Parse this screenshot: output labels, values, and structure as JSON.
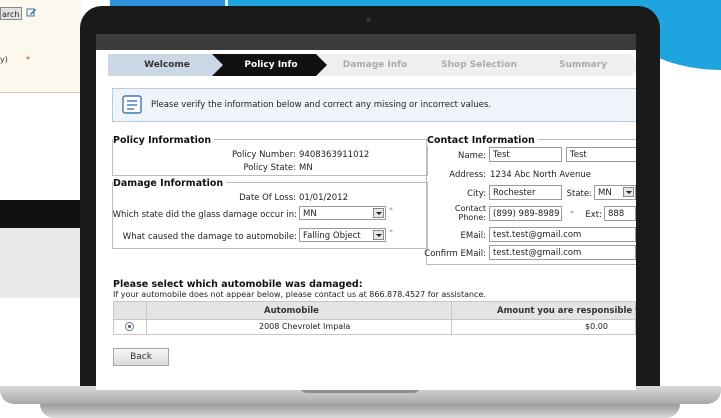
{
  "background_page": {
    "search_button": "arch",
    "y_text": "y)",
    "required_mark": "*"
  },
  "wizard": {
    "steps": [
      {
        "label": "Welcome",
        "state": "done"
      },
      {
        "label": "Policy Info",
        "state": "active"
      },
      {
        "label": "Damage Info",
        "state": "todo"
      },
      {
        "label": "Shop Selection",
        "state": "todo"
      },
      {
        "label": "Summary",
        "state": "todo"
      }
    ]
  },
  "notice": {
    "text": "Please verify the information below and correct any missing or incorrect values.",
    "icon": "document-icon"
  },
  "policy": {
    "title": "Policy Information",
    "number_label": "Policy Number:",
    "number_value": "9408363911012",
    "state_label": "Policy State:",
    "state_value": "MN"
  },
  "damage": {
    "title": "Damage Information",
    "date_label": "Date Of Loss:",
    "date_value": "01/01/2012",
    "state_question": "Which state did the glass damage occur in:",
    "state_selected": "MN",
    "cause_question": "What caused the damage to automobile:",
    "cause_selected": "Falling Object",
    "required_mark": "*"
  },
  "contact": {
    "title": "Contact Information",
    "name_label": "Name:",
    "first_name": "Test",
    "last_name": "Test",
    "address_label": "Address:",
    "address_value": "1234 Abc North Avenue",
    "city_label": "City:",
    "city_value": "Rochester",
    "state_label": "State:",
    "state_selected": "MN",
    "phone_label": "Contact Phone:",
    "phone_value": "(899) 989-8989",
    "required_mark": "*",
    "ext_label": "Ext:",
    "ext_value": "888",
    "email_label": "EMail:",
    "email_value": "test.test@gmail.com",
    "confirm_email_label": "Confirm EMail:",
    "confirm_email_value": "test.test@gmail.com"
  },
  "automobile": {
    "heading": "Please select which automobile was damaged:",
    "subtext": "If your automobile does not appear below, please contact us at 866.878.4527 for assistance.",
    "columns": [
      "Automobile",
      "Amount you are responsible for"
    ],
    "rows": [
      {
        "selected": true,
        "automobile": "2008 Chevrolet Impala",
        "amount": "$0.00"
      }
    ]
  },
  "buttons": {
    "back": "Back"
  },
  "colors": {
    "active_step": "#111111",
    "notice_bg": "#eef4fa",
    "backdrop_blue": "#1ea5e0"
  }
}
